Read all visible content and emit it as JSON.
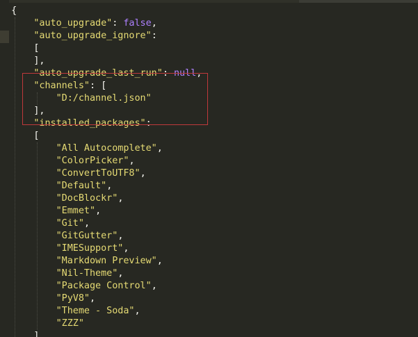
{
  "editor": {
    "lines": [
      {
        "indent": "",
        "parts": [
          {
            "t": "p",
            "v": "{"
          }
        ]
      },
      {
        "indent": "    ",
        "parts": [
          {
            "t": "s",
            "v": "\"auto_upgrade\""
          },
          {
            "t": "p",
            "v": ": "
          },
          {
            "t": "kw",
            "v": "false"
          },
          {
            "t": "p",
            "v": ","
          }
        ]
      },
      {
        "indent": "    ",
        "parts": [
          {
            "t": "s",
            "v": "\"auto_upgrade_ignore\""
          },
          {
            "t": "p",
            "v": ":"
          }
        ]
      },
      {
        "indent": "    ",
        "parts": [
          {
            "t": "p",
            "v": "["
          }
        ]
      },
      {
        "indent": "    ",
        "parts": [
          {
            "t": "p",
            "v": "],"
          }
        ]
      },
      {
        "indent": "    ",
        "parts": [
          {
            "t": "s",
            "v": "\"auto_upgrade_last_run\""
          },
          {
            "t": "p",
            "v": ": "
          },
          {
            "t": "kw",
            "v": "null"
          },
          {
            "t": "p",
            "v": ","
          }
        ]
      },
      {
        "indent": "    ",
        "parts": [
          {
            "t": "s",
            "v": "\"channels\""
          },
          {
            "t": "p",
            "v": ": ["
          }
        ]
      },
      {
        "indent": "        ",
        "parts": [
          {
            "t": "s",
            "v": "\"D:/channel.json\""
          }
        ]
      },
      {
        "indent": "    ",
        "parts": [
          {
            "t": "p",
            "v": "],"
          }
        ]
      },
      {
        "indent": "    ",
        "parts": [
          {
            "t": "s",
            "v": "\"installed_packages\""
          },
          {
            "t": "p",
            "v": ":"
          }
        ]
      },
      {
        "indent": "    ",
        "parts": [
          {
            "t": "p",
            "v": "["
          }
        ]
      },
      {
        "indent": "        ",
        "parts": [
          {
            "t": "s",
            "v": "\"All Autocomplete\""
          },
          {
            "t": "p",
            "v": ","
          }
        ]
      },
      {
        "indent": "        ",
        "parts": [
          {
            "t": "s",
            "v": "\"ColorPicker\""
          },
          {
            "t": "p",
            "v": ","
          }
        ]
      },
      {
        "indent": "        ",
        "parts": [
          {
            "t": "s",
            "v": "\"ConvertToUTF8\""
          },
          {
            "t": "p",
            "v": ","
          }
        ]
      },
      {
        "indent": "        ",
        "parts": [
          {
            "t": "s",
            "v": "\"Default\""
          },
          {
            "t": "p",
            "v": ","
          }
        ]
      },
      {
        "indent": "        ",
        "parts": [
          {
            "t": "s",
            "v": "\"DocBlockr\""
          },
          {
            "t": "p",
            "v": ","
          }
        ]
      },
      {
        "indent": "        ",
        "parts": [
          {
            "t": "s",
            "v": "\"Emmet\""
          },
          {
            "t": "p",
            "v": ","
          }
        ]
      },
      {
        "indent": "        ",
        "parts": [
          {
            "t": "s",
            "v": "\"Git\""
          },
          {
            "t": "p",
            "v": ","
          }
        ]
      },
      {
        "indent": "        ",
        "parts": [
          {
            "t": "s",
            "v": "\"GitGutter\""
          },
          {
            "t": "p",
            "v": ","
          }
        ]
      },
      {
        "indent": "        ",
        "parts": [
          {
            "t": "s",
            "v": "\"IMESupport\""
          },
          {
            "t": "p",
            "v": ","
          }
        ]
      },
      {
        "indent": "        ",
        "parts": [
          {
            "t": "s",
            "v": "\"Markdown Preview\""
          },
          {
            "t": "p",
            "v": ","
          }
        ]
      },
      {
        "indent": "        ",
        "parts": [
          {
            "t": "s",
            "v": "\"Nil-Theme\""
          },
          {
            "t": "p",
            "v": ","
          }
        ]
      },
      {
        "indent": "        ",
        "parts": [
          {
            "t": "s",
            "v": "\"Package Control\""
          },
          {
            "t": "p",
            "v": ","
          }
        ]
      },
      {
        "indent": "        ",
        "parts": [
          {
            "t": "s",
            "v": "\"PyV8\""
          },
          {
            "t": "p",
            "v": ","
          }
        ]
      },
      {
        "indent": "        ",
        "parts": [
          {
            "t": "s",
            "v": "\"Theme - Soda\""
          },
          {
            "t": "p",
            "v": ","
          }
        ]
      },
      {
        "indent": "        ",
        "parts": [
          {
            "t": "s",
            "v": "\"ZZZ\""
          }
        ]
      },
      {
        "indent": "    ",
        "parts": [
          {
            "t": "p",
            "v": "]"
          }
        ]
      }
    ]
  },
  "colors": {
    "background": "#272822",
    "string": "#e6db74",
    "keyword": "#ae81ff",
    "punctuation": "#f8f8f2",
    "annotation_box": "#c0393b"
  }
}
